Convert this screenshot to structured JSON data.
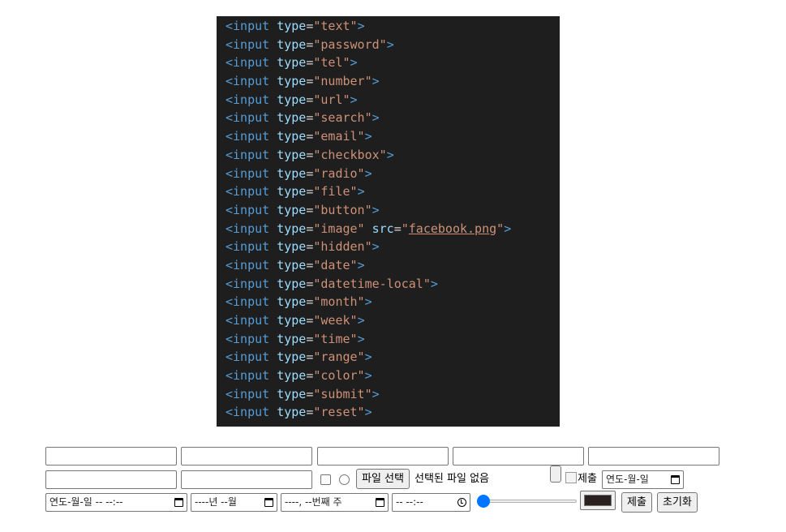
{
  "code": {
    "lines": [
      {
        "tag": "<input",
        "attr": "type",
        "eq": "=",
        "val": "\"text\"",
        "end": ">"
      },
      {
        "tag": "<input",
        "attr": "type",
        "eq": "=",
        "val": "\"password\"",
        "end": ">"
      },
      {
        "tag": "<input",
        "attr": "type",
        "eq": "=",
        "val": "\"tel\"",
        "end": ">"
      },
      {
        "tag": "<input",
        "attr": "type",
        "eq": "=",
        "val": "\"number\"",
        "end": ">"
      },
      {
        "tag": "<input",
        "attr": "type",
        "eq": "=",
        "val": "\"url\"",
        "end": ">"
      },
      {
        "tag": "<input",
        "attr": "type",
        "eq": "=",
        "val": "\"search\"",
        "end": ">"
      },
      {
        "tag": "<input",
        "attr": "type",
        "eq": "=",
        "val": "\"email\"",
        "end": ">"
      },
      {
        "tag": "<input",
        "attr": "type",
        "eq": "=",
        "val": "\"checkbox\"",
        "end": ">"
      },
      {
        "tag": "<input",
        "attr": "type",
        "eq": "=",
        "val": "\"radio\"",
        "end": ">"
      },
      {
        "tag": "<input",
        "attr": "type",
        "eq": "=",
        "val": "\"file\"",
        "end": ">"
      },
      {
        "tag": "<input",
        "attr": "type",
        "eq": "=",
        "val": "\"button\"",
        "end": ">"
      },
      {
        "tag": "<input",
        "attr": "type",
        "eq": "=",
        "val": "\"image\"",
        "attr2": "src",
        "eq2": "=",
        "q1": "\"",
        "link": "facebook.png",
        "q2": "\"",
        "end": ">"
      },
      {
        "tag": "<input",
        "attr": "type",
        "eq": "=",
        "val": "\"hidden\"",
        "end": ">"
      },
      {
        "tag": "<input",
        "attr": "type",
        "eq": "=",
        "val": "\"date\"",
        "end": ">"
      },
      {
        "tag": "<input",
        "attr": "type",
        "eq": "=",
        "val": "\"datetime-local\"",
        "end": ">"
      },
      {
        "tag": "<input",
        "attr": "type",
        "eq": "=",
        "val": "\"month\"",
        "end": ">"
      },
      {
        "tag": "<input",
        "attr": "type",
        "eq": "=",
        "val": "\"week\"",
        "end": ">"
      },
      {
        "tag": "<input",
        "attr": "type",
        "eq": "=",
        "val": "\"time\"",
        "end": ">"
      },
      {
        "tag": "<input",
        "attr": "type",
        "eq": "=",
        "val": "\"range\"",
        "end": ">"
      },
      {
        "tag": "<input",
        "attr": "type",
        "eq": "=",
        "val": "\"color\"",
        "end": ">"
      },
      {
        "tag": "<input",
        "attr": "type",
        "eq": "=",
        "val": "\"submit\"",
        "end": ">"
      },
      {
        "tag": "<input",
        "attr": "type",
        "eq": "=",
        "val": "\"reset\"",
        "end": ">"
      }
    ]
  },
  "form": {
    "file_button_label": "파일 선택",
    "file_status": "선택된 파일 없음",
    "image_alt": "제출",
    "date_value": "연도-월-일",
    "datetime_value": "연도-월-일 -- --:--",
    "month_value": "----년 --월",
    "week_value": "----, --번째 주",
    "time_value": "-- --:--",
    "color_value": "#2b2020",
    "range_value": 0,
    "submit_label": "제출",
    "reset_label": "초기화"
  },
  "icons": {
    "calendar": "calendar-icon",
    "clock": "clock-icon",
    "broken_image": "broken-image-icon"
  }
}
